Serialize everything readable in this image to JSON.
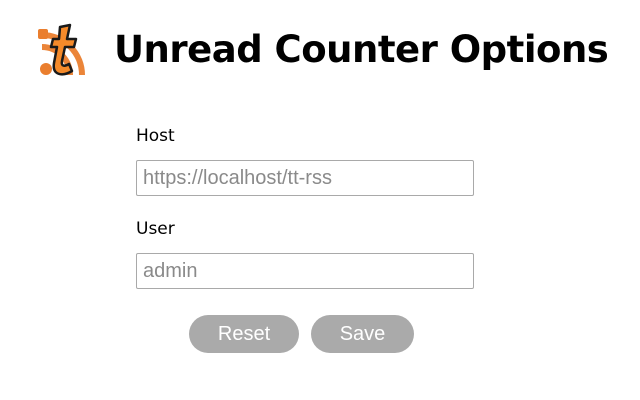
{
  "header": {
    "title": "Unread Counter Options",
    "logo_icon": "tt-rss-logo-icon",
    "logo_colors": {
      "accent": "#ea7e2e",
      "letter": "#f58a2a",
      "outline": "#1a1a1a"
    }
  },
  "form": {
    "host_label": "Host",
    "host_placeholder": "https://localhost/tt-rss",
    "host_value": "",
    "user_label": "User",
    "user_placeholder": "admin",
    "user_value": ""
  },
  "buttons": {
    "reset_label": "Reset",
    "save_label": "Save",
    "color": "#aaaaaa"
  }
}
